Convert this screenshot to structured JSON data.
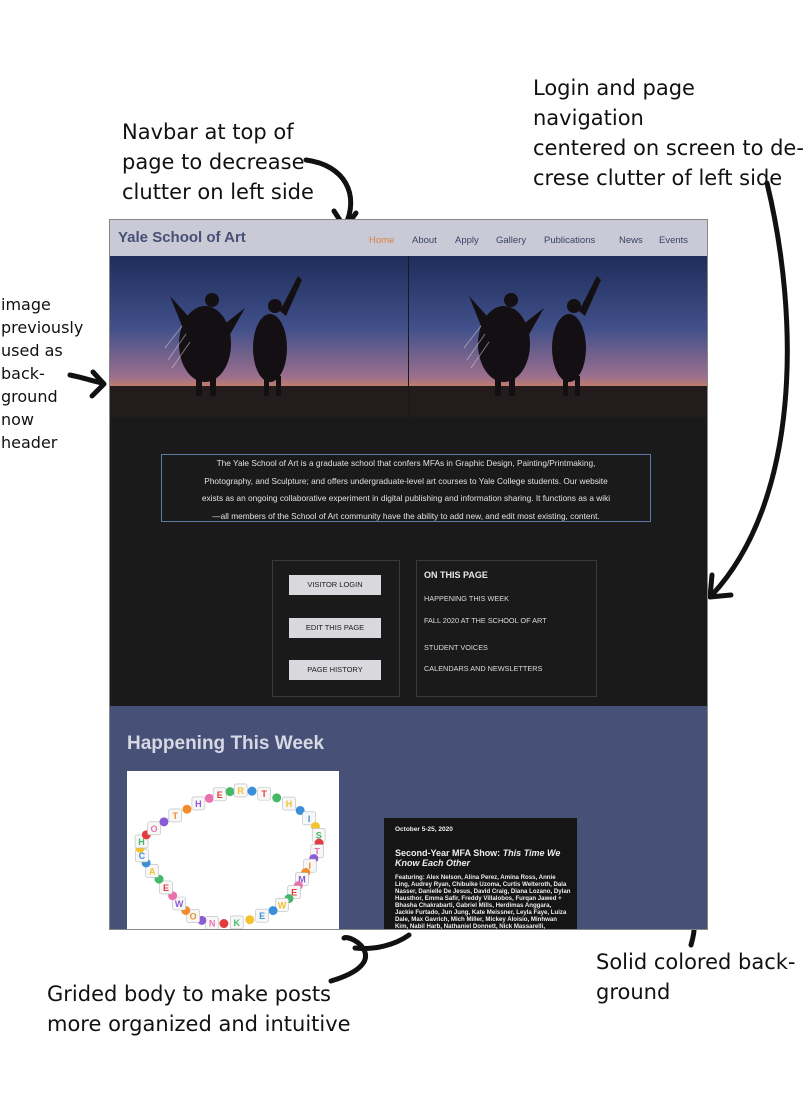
{
  "annotations": {
    "navbar_note": [
      "Navbar at top of",
      "page to decrease",
      "clutter on left side"
    ],
    "login_note": [
      "Login and page navigation",
      "centered on screen to de-",
      "crese clutter of left side"
    ],
    "image_note": [
      "image",
      "previously",
      "used as",
      "back-",
      "ground",
      "now",
      "header"
    ],
    "grid_note": [
      "Grided body to make posts",
      "more organized and intuitive"
    ],
    "solid_note": [
      "Solid colored back-",
      "ground"
    ]
  },
  "colors": {
    "navbar_bg": "#c9cad6",
    "brand_text": "#474f75",
    "active_link": "#d88344",
    "dark_bg": "#1b1a1b",
    "section_bg": "#475077",
    "intro_border": "#5c7aa6"
  },
  "site": {
    "brand": "Yale School of Art",
    "nav": [
      "Home",
      "About",
      "Apply",
      "Gallery",
      "Publications",
      "News",
      "Events"
    ],
    "active_nav": "Home",
    "intro_lines": [
      "The Yale School of Art is a graduate school that confers MFAs in Graphic Design, Painting/Printmaking,",
      "Photography, and Sculpture; and offers undergraduate-level art courses to Yale College students. Our website",
      "exists as an ongoing collaborative experiment in digital publishing and information sharing. It functions as a wiki",
      "—all members of the School of Art community have the ability to add new, and edit most existing, content."
    ],
    "buttons": [
      "VISITOR LOGIN",
      "EDIT THIS PAGE",
      "PAGE HISTORY"
    ],
    "on_this_page": {
      "title": "ON THIS PAGE",
      "links": [
        "HAPPENING THIS WEEK",
        "FALL 2020 AT THE SCHOOL OF ART",
        "STUDENT VOICES",
        "CALENDARS AND NEWSLETTERS"
      ]
    },
    "section_title": "Happening This Week",
    "bracelet_letters": [
      "T",
      "H",
      "I",
      "S",
      "T",
      "I",
      "M",
      "E",
      "W",
      "E",
      "K",
      "N",
      "O",
      "W",
      "E",
      "A",
      "C",
      "H",
      "O",
      "T",
      "H",
      "E",
      "R"
    ],
    "event": {
      "date": "October 5-25, 2020",
      "title_plain": "Second-Year MFA Show: ",
      "title_italic": "This Time We Know Each Other",
      "description": "Featuring: Alex Nelson, Alina Perez, Amina Ross, Annie Ling, Audrey Ryan, Chibuike Uzoma, Curtis Welteroth, Dala Nasser, Danielle De Jesus, David Craig, Diana Lozano, Dylan Hausthor, Emma Safir, Freddy Villalobos, Furqan Jawed + Bhasha Chakrabarti, Gabriel Mills, Herdimas Anggara, Jackie Furtado, Jun Jung, Kate Meissner, Leyla Faye, Luiza Dale, Max Gavrich, Mich Miller, Mickey Aloisio, Minhwan Kim, Nabil Harb, Nathaniel Donnett, Nick Massarelli, Rosemary Warren,"
    }
  }
}
